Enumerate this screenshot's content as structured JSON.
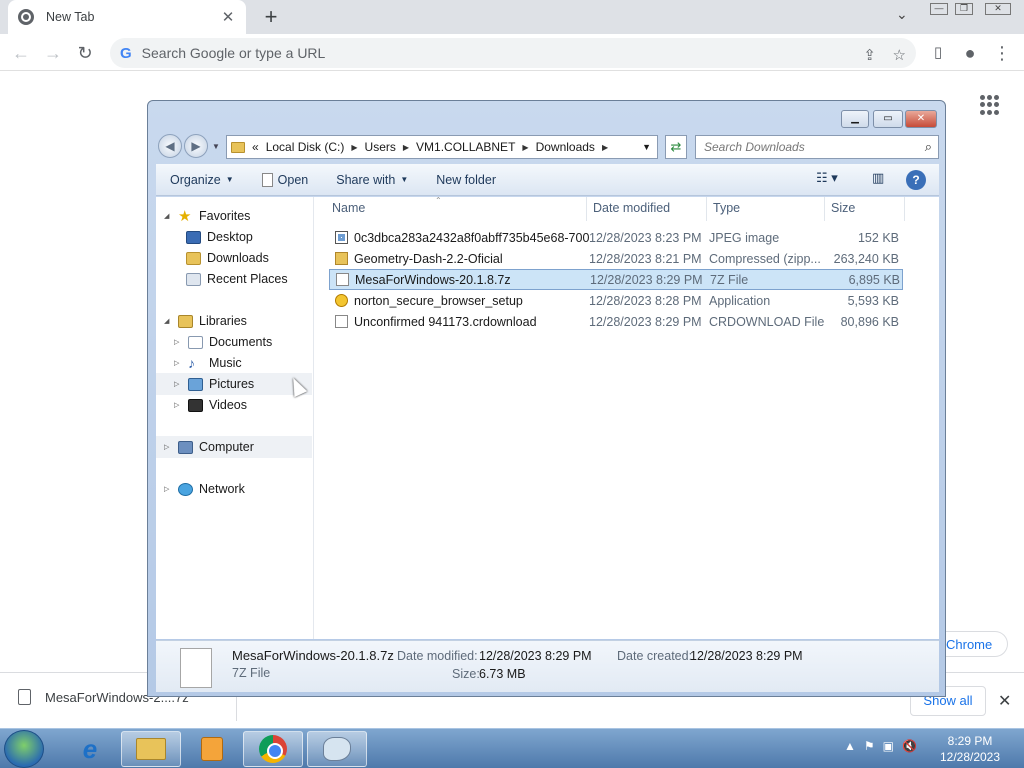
{
  "browser": {
    "tab_title": "New Tab",
    "tab_close": "✕",
    "new_tab": "+",
    "tabstrip_menu": "⌄",
    "omnibox_placeholder": "Search Google or type a URL",
    "ntp_partial_text": "Chrome",
    "download_item": "MesaForWindows-2....7z",
    "download_expand": "⌃",
    "show_all": "Show all",
    "download_close": "✕"
  },
  "explorer": {
    "breadcrumb": [
      "Local Disk (C:)",
      "Users",
      "VM1.COLLABNET",
      "Downloads"
    ],
    "breadcrumb_overflow": "«",
    "search_placeholder": "Search Downloads",
    "toolbar": {
      "organize": "Organize",
      "open": "Open",
      "share_with": "Share with",
      "new_folder": "New folder"
    },
    "nav": {
      "favorites": "Favorites",
      "desktop": "Desktop",
      "downloads": "Downloads",
      "recent_places": "Recent Places",
      "libraries": "Libraries",
      "documents": "Documents",
      "music": "Music",
      "pictures": "Pictures",
      "videos": "Videos",
      "computer": "Computer",
      "network": "Network"
    },
    "columns": {
      "name": "Name",
      "date": "Date modified",
      "type": "Type",
      "size": "Size"
    },
    "files": [
      {
        "name": "0c3dbca283a2432a8f0abff735b45e68-700",
        "date": "12/28/2023 8:23 PM",
        "type": "JPEG image",
        "size": "152 KB"
      },
      {
        "name": "Geometry-Dash-2.2-Oficial",
        "date": "12/28/2023 8:21 PM",
        "type": "Compressed (zipp...",
        "size": "263,240 KB"
      },
      {
        "name": "MesaForWindows-20.1.8.7z",
        "date": "12/28/2023 8:29 PM",
        "type": "7Z File",
        "size": "6,895 KB"
      },
      {
        "name": "norton_secure_browser_setup",
        "date": "12/28/2023 8:28 PM",
        "type": "Application",
        "size": "5,593 KB"
      },
      {
        "name": "Unconfirmed 941173.crdownload",
        "date": "12/28/2023 8:29 PM",
        "type": "CRDOWNLOAD File",
        "size": "80,896 KB"
      }
    ],
    "selected_index": 2,
    "details": {
      "name": "MesaForWindows-20.1.8.7z",
      "type": "7Z File",
      "date_modified_label": "Date modified:",
      "date_modified": "12/28/2023 8:29 PM",
      "date_created_label": "Date created:",
      "date_created": "12/28/2023 8:29 PM",
      "size_label": "Size:",
      "size": "6.73 MB"
    }
  },
  "taskbar": {
    "time": "8:29 PM",
    "date": "12/28/2023"
  }
}
